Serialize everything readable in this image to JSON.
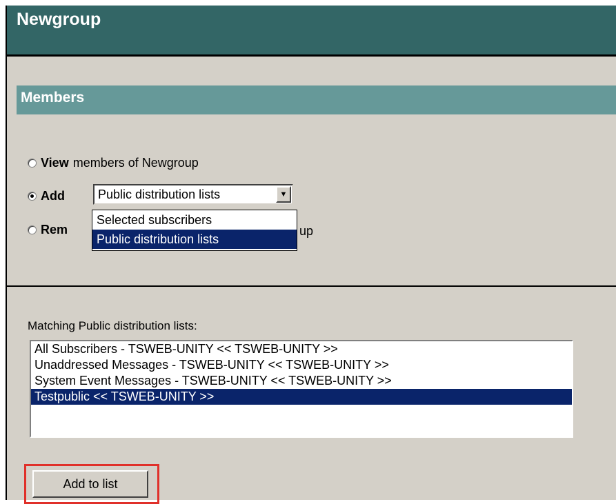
{
  "header": {
    "title": "Newgroup"
  },
  "section": {
    "title": "Members"
  },
  "options": {
    "view": {
      "bold": "View",
      "rest": "members of Newgroup"
    },
    "add": {
      "bold": "Add"
    },
    "remove": {
      "bold_visible": "Rem",
      "rest_visible": "up"
    }
  },
  "add_select": {
    "selected_value": "Public distribution lists",
    "options": [
      "Selected subscribers",
      "Public distribution lists"
    ],
    "highlighted_index": 1
  },
  "matching": {
    "label": "Matching Public distribution lists:",
    "items": [
      "All Subscribers - TSWEB-UNITY << TSWEB-UNITY >>",
      "Unaddressed Messages - TSWEB-UNITY << TSWEB-UNITY >>",
      "System Event Messages - TSWEB-UNITY << TSWEB-UNITY >>",
      "Testpublic << TSWEB-UNITY >>"
    ],
    "selected_index": 3
  },
  "actions": {
    "add_to_list": "Add to list"
  },
  "colors": {
    "title_bar": "#336666",
    "section_band": "#669999",
    "panel": "#d4d0c8",
    "selection": "#0a246a",
    "highlight_outline": "#e0302a"
  }
}
